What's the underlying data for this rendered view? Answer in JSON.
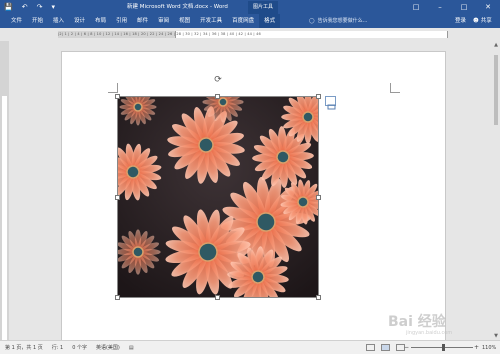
{
  "quick_access": {
    "save_icon": "save-icon",
    "undo_icon": "undo-icon",
    "redo_icon": "redo-icon",
    "customize_icon": "customize-icon"
  },
  "window_title": "新建 Microsoft Word 文档.docx - Word",
  "contextual_tab_group": "图片工具",
  "ribbon_tabs": [
    {
      "label": "文件"
    },
    {
      "label": "开始"
    },
    {
      "label": "插入"
    },
    {
      "label": "设计"
    },
    {
      "label": "布局"
    },
    {
      "label": "引用"
    },
    {
      "label": "邮件"
    },
    {
      "label": "审阅"
    },
    {
      "label": "视图"
    },
    {
      "label": "开发工具"
    },
    {
      "label": "百度网盘"
    },
    {
      "label": "格式"
    }
  ],
  "active_tab": "格式",
  "tell_me": "告诉我您想要做什么...",
  "sign_in": "登录",
  "share": "共享",
  "ruler_numbers": "|2|  1  |  2  |  4  |  6  |  8  |  10  |  12  |  14  |  16  |  18  |  20  |  22  |  24  |  26  |  28  |  30  |  32  |  34  |  36  |  38  |  40  |  42  |  44  |  46",
  "status": {
    "page": "第 1 页，共 1 页",
    "line": "行: 1",
    "words": "0 个字",
    "language": "英语(美国)"
  },
  "zoom": {
    "percent": "110%",
    "level": 110
  },
  "watermark": {
    "text": "Bai 经验",
    "sub": "jingyan.baidu.com"
  },
  "colors": {
    "ribbon_blue": "#2b579a",
    "petal_orange": "#f07a5a",
    "petal_light": "#ffb499",
    "image_dark": "#2d2327",
    "flower_center": "#2f5963"
  }
}
